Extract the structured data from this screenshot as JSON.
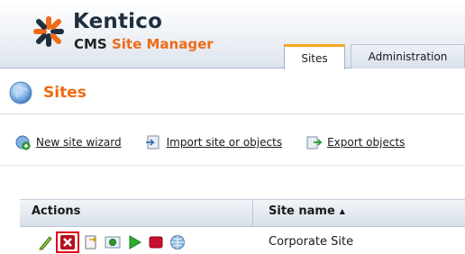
{
  "brand": {
    "name": "Kentico",
    "product_prefix": "CMS",
    "product_suffix": "Site Manager"
  },
  "tabs": [
    {
      "label": "Sites",
      "active": true
    },
    {
      "label": "Administration",
      "active": false
    }
  ],
  "page": {
    "title": "Sites"
  },
  "actions": [
    {
      "label": "New site wizard",
      "icon": "new-site-icon"
    },
    {
      "label": "Import site or objects",
      "icon": "import-icon"
    },
    {
      "label": "Export objects",
      "icon": "export-icon"
    }
  ],
  "grid": {
    "columns": [
      {
        "label": "Actions"
      },
      {
        "label": "Site name",
        "sort": "ascending"
      }
    ],
    "rows": [
      {
        "site_name": "Corporate Site",
        "row_actions": [
          "edit-icon",
          "delete-icon",
          "export-site-icon",
          "preview-icon",
          "start-icon",
          "stop-icon",
          "open-live-site-icon"
        ]
      }
    ]
  },
  "colors": {
    "title_orange": "#ee6a12",
    "accent_orange": "#ef6b19",
    "highlight_red": "#e2001a"
  }
}
